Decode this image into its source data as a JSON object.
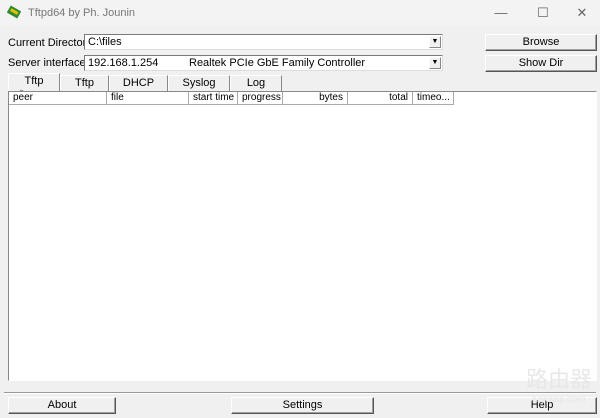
{
  "window": {
    "title": "Tftpd64 by Ph. Jounin",
    "minimize": "—",
    "maximize": "☐",
    "close": "✕"
  },
  "form": {
    "current_directory_label": "Current Directory",
    "current_directory_value": "C:\\files",
    "server_interfaces_label": "Server interfaces",
    "server_ip": "192.168.1.254",
    "server_adapter": "Realtek PCIe GbE Family Controller",
    "browse_label": "Browse",
    "show_dir_label": "Show Dir"
  },
  "tabs": [
    "Tftp Server",
    "Tftp Client",
    "DHCP server",
    "Syslog server",
    "Log viewer"
  ],
  "columns": [
    "peer",
    "file",
    "start time",
    "progress",
    "bytes",
    "total",
    "timeo..."
  ],
  "buttons": {
    "about": "About",
    "settings": "Settings",
    "help": "Help"
  },
  "watermark": {
    "text": "路由器",
    "url": "luyouqi.com"
  }
}
